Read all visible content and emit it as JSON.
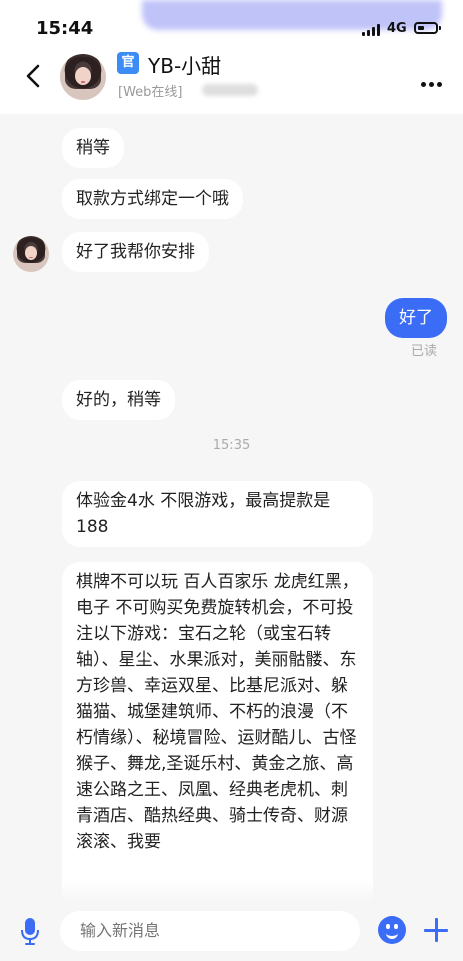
{
  "status": {
    "time": "15:44",
    "network": "4G"
  },
  "header": {
    "badge": "官",
    "title": "YB-小甜",
    "presence": "[Web在线]"
  },
  "messages": {
    "m1": "稍等",
    "m2": "取款方式绑定一个哦",
    "m3": "好了我帮你安排",
    "m4": "好了",
    "m4_status": "已读",
    "m5": "好的，稍等",
    "timestamp": "15:35",
    "m6": "体验金4水 不限游戏，最高提款是188",
    "m7": "棋牌不可以玩 百人百家乐 龙虎红黑，电子 不可购买免费旋转机会，不可投注以下游戏：宝石之轮（或宝石转轴）、星尘、水果派对，美丽骷髅、东方珍兽、幸运双星、比基尼派对、躲猫猫、城堡建筑师、不朽的浪漫（不朽情缘）、秘境冒险、运财酷儿、古怪猴子、舞龙,圣诞乐村、黄金之旅、高速公路之王、凤凰、经典老虎机、刺青酒店、酷热经典、骑士传奇、财源滚滚、我要"
  },
  "input": {
    "placeholder": "输入新消息"
  },
  "icons": {
    "back": "chevron-left-icon",
    "more": "more-dots-icon",
    "mic": "microphone-icon",
    "emoji": "emoji-icon",
    "plus": "plus-icon"
  },
  "colors": {
    "accent": "#3b6cf6",
    "official_badge": "#3c8cf5",
    "bubble": "#ffffff",
    "background": "#f6f6f6"
  }
}
